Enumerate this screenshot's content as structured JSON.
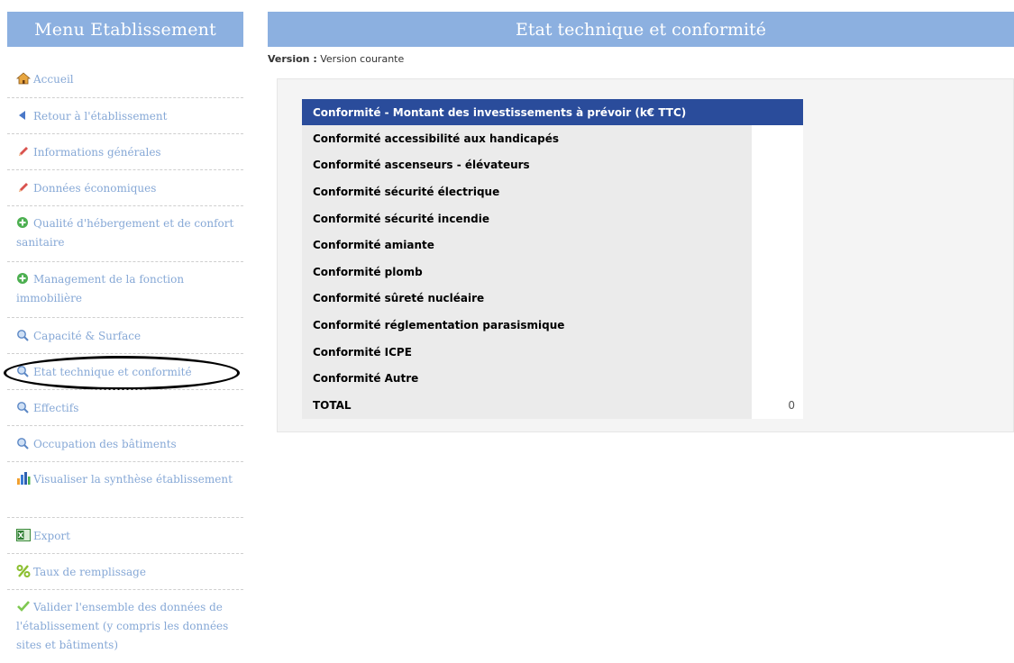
{
  "sidebar": {
    "title": "Menu Etablissement",
    "items": [
      {
        "label": "Accueil",
        "icon": "house-icon"
      },
      {
        "label": "Retour à l'établissement",
        "icon": "arrow-left-icon"
      },
      {
        "label": "Informations générales",
        "icon": "pencil-icon"
      },
      {
        "label": "Données économiques",
        "icon": "pencil-icon"
      },
      {
        "label": "Qualité d'hébergement et de confort sanitaire",
        "icon": "plus-circle-icon"
      },
      {
        "label": "Management de la fonction immobilière",
        "icon": "plus-circle-icon"
      },
      {
        "label": "Capacité & Surface",
        "icon": "magnifier-icon"
      },
      {
        "label": "Etat technique et conformité",
        "icon": "magnifier-icon"
      },
      {
        "label": "Effectifs",
        "icon": "magnifier-icon"
      },
      {
        "label": "Occupation des bâtiments",
        "icon": "magnifier-icon"
      },
      {
        "label": "Visualiser la synthèse établissement",
        "icon": "bar-chart-icon"
      },
      {
        "label": "Export",
        "icon": "excel-icon"
      },
      {
        "label": "Taux de remplissage",
        "icon": "percent-icon"
      },
      {
        "label": "Valider l'ensemble des données de l'établissement (y compris les données sites et bâtiments)",
        "icon": "checkmark-icon"
      }
    ]
  },
  "main": {
    "title": "Etat technique et conformité",
    "version_label": "Version :",
    "version_value": "Version courante"
  },
  "table": {
    "header": "Conformité - Montant des investissements à prévoir (k€ TTC)",
    "rows": [
      {
        "label": "Conformité accessibilité aux handicapés",
        "value": ""
      },
      {
        "label": "Conformité ascenseurs - élévateurs",
        "value": ""
      },
      {
        "label": "Conformité sécurité électrique",
        "value": ""
      },
      {
        "label": "Conformité sécurité incendie",
        "value": ""
      },
      {
        "label": "Conformité amiante",
        "value": ""
      },
      {
        "label": "Conformité plomb",
        "value": ""
      },
      {
        "label": "Conformité sûreté nucléaire",
        "value": ""
      },
      {
        "label": "Conformité réglementation parasismique",
        "value": ""
      },
      {
        "label": "Conformité ICPE",
        "value": ""
      },
      {
        "label": "Conformité Autre",
        "value": ""
      },
      {
        "label": "TOTAL",
        "value": "0"
      }
    ]
  },
  "colors": {
    "header_bg": "#8cb0e0",
    "table_header_bg": "#2a4c9b",
    "menu_link": "#86a8d6"
  }
}
